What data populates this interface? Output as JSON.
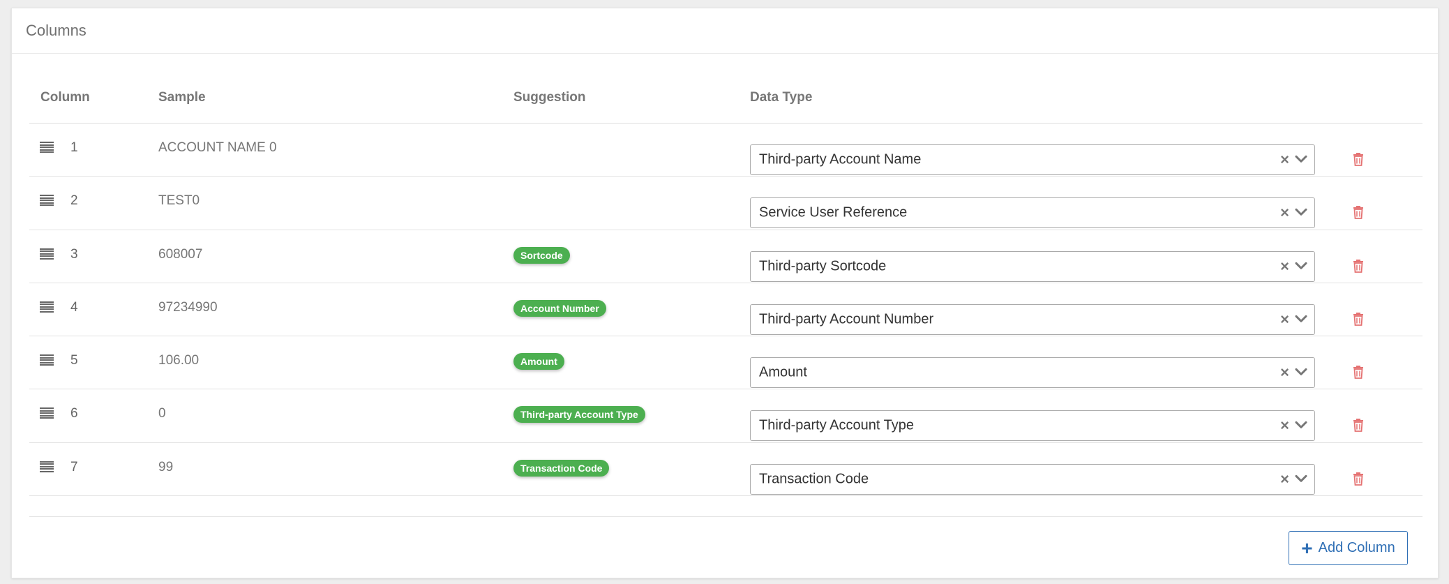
{
  "card": {
    "title": "Columns"
  },
  "table": {
    "headers": {
      "column": "Column",
      "sample": "Sample",
      "suggestion": "Suggestion",
      "data_type": "Data Type"
    },
    "rows": [
      {
        "num": "1",
        "sample": "ACCOUNT NAME 0",
        "suggestion": "",
        "data_type": "Third-party Account Name"
      },
      {
        "num": "2",
        "sample": "TEST0",
        "suggestion": "",
        "data_type": "Service User Reference"
      },
      {
        "num": "3",
        "sample": "608007",
        "suggestion": "Sortcode",
        "data_type": "Third-party Sortcode"
      },
      {
        "num": "4",
        "sample": "97234990",
        "suggestion": "Account Number",
        "data_type": "Third-party Account Number"
      },
      {
        "num": "5",
        "sample": "106.00",
        "suggestion": "Amount",
        "data_type": "Amount"
      },
      {
        "num": "6",
        "sample": "0",
        "suggestion": "Third-party Account Type",
        "data_type": "Third-party Account Type"
      },
      {
        "num": "7",
        "sample": "99",
        "suggestion": "Transaction Code",
        "data_type": "Transaction Code"
      }
    ]
  },
  "select": {
    "clear_glyph": "×"
  },
  "footer": {
    "add_plus": "+",
    "add_label": "Add Column"
  },
  "icons": {
    "drag": "drag-handle-icon",
    "clear": "clear-icon",
    "chevron": "chevron-down-icon",
    "trash": "trash-icon",
    "plus": "plus-icon"
  },
  "colors": {
    "badge": "#4caf50",
    "trash": "#e57373",
    "accent": "#2f6fb5",
    "card_background": "#ffffff",
    "page_background": "#eeeeee"
  }
}
